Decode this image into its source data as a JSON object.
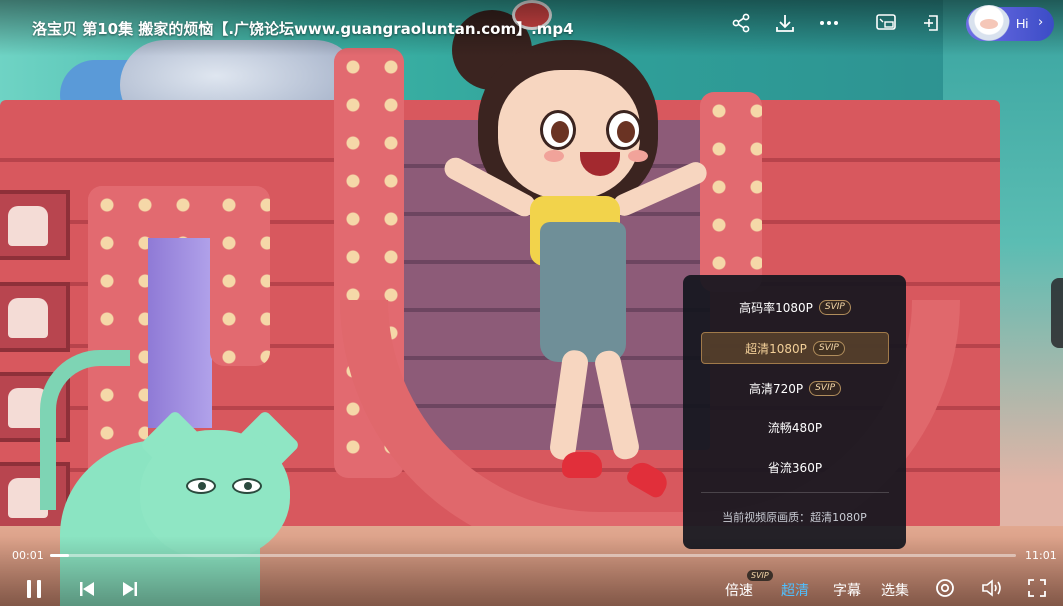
{
  "window": {
    "title": "洛宝贝 第10集 搬家的烦恼【.广饶论坛www.guangraoluntan.com】.mp4"
  },
  "top_icons": [
    {
      "name": "share-icon"
    },
    {
      "name": "download-icon"
    },
    {
      "name": "more-icon"
    },
    {
      "name": "screen-cast-icon"
    },
    {
      "name": "pin-icon"
    }
  ],
  "assistant": {
    "label": "Hi",
    "chevron": "›"
  },
  "quality_menu": {
    "items": [
      {
        "label": "高码率1080P",
        "badge": "SVIP",
        "selected": false
      },
      {
        "label": "超清1080P",
        "badge": "SVIP",
        "selected": true
      },
      {
        "label": "高清720P",
        "badge": "SVIP",
        "selected": false
      },
      {
        "label": "流畅480P",
        "badge": "",
        "selected": false
      },
      {
        "label": "省流360P",
        "badge": "",
        "selected": false
      }
    ],
    "note": "当前视频原画质：超清1080P"
  },
  "playback": {
    "current_time": "00:01",
    "duration": "11:01",
    "progress": 0.0015
  },
  "controls": {
    "speed_label": "倍速",
    "speed_badge": "SVIP",
    "quality_label": "超清",
    "subtitle_label": "字幕",
    "episodes_label": "选集"
  },
  "colors": {
    "accent": "#4fc0ff",
    "svip": "#f4d7a8",
    "menu_bg": "#14161e",
    "selected_item": "#f2cf98"
  }
}
